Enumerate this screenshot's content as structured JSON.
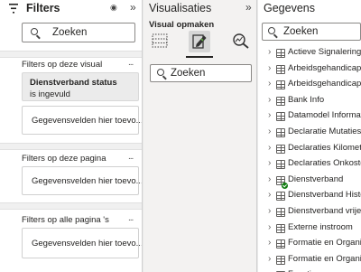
{
  "filters": {
    "title": "Filters",
    "search_placeholder": "Zoeken",
    "sections": {
      "visual": {
        "label": "Filters op deze visual",
        "more": "...",
        "filter_title": "Dienstverband status",
        "filter_state": "is ingevuld",
        "drop_zone": "Gegevensvelden hier toevo..."
      },
      "page": {
        "label": "Filters op deze pagina",
        "more": "...",
        "drop_zone": "Gegevensvelden hier toevo..."
      },
      "all_pages": {
        "label": "Filters op alle pagina 's",
        "more": "...",
        "drop_zone": "Gegevensvelden hier toevo..."
      }
    },
    "icons": {
      "filter": "funnel-icon",
      "visibility": "eye-icon",
      "collapse": "double-chevron-right-icon"
    }
  },
  "visualizations": {
    "title": "Visualisaties",
    "subtitle": "Visual opmaken",
    "search_placeholder": "Zoeken",
    "tools": [
      "build-visual-icon",
      "format-visual-icon",
      "analytics-icon"
    ],
    "active_tool": "format-visual-icon"
  },
  "data": {
    "title": "Gegevens",
    "search_placeholder": "Zoeken",
    "tables": [
      "Actieve Signalering",
      "Arbeidsgehandicapt",
      "Arbeidsgehandicapt ...",
      "Bank Info",
      "Datamodel Informatie",
      "Declaratie Mutaties",
      "Declaraties Kilometers",
      "Declaraties Onkosten",
      "Dienstverband",
      "Dienstverband Histo...",
      "Dienstverband vrije v...",
      "Externe instroom",
      "Formatie en Organis...",
      "Formatie en Organis...",
      "Functie"
    ],
    "checked_table": "Dienstverband"
  },
  "colors": {
    "accent_check": "#107c10",
    "pane_gray": "#f3f2f1"
  }
}
